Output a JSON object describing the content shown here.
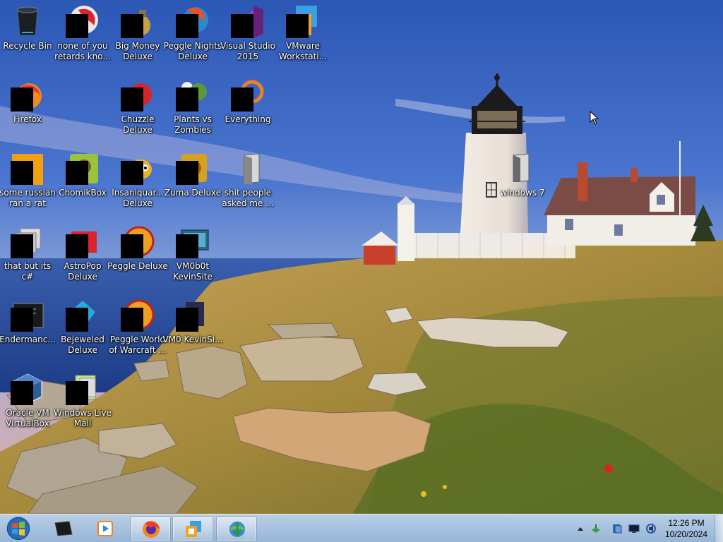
{
  "desktop": {
    "icons": [
      {
        "label": "Recycle Bin",
        "icon": "recycle-bin-icon"
      },
      {
        "label": "none of you retards kno...",
        "icon": "app-icon"
      },
      {
        "label": "Big Money Deluxe",
        "icon": "game-icon"
      },
      {
        "label": "Peggle Nights Deluxe",
        "icon": "game-icon"
      },
      {
        "label": "Visual Studio 2015",
        "icon": "visual-studio-icon"
      },
      {
        "label": "VMware Workstati...",
        "icon": "vmware-icon"
      },
      {
        "label": "Firefox",
        "icon": "firefox-icon"
      },
      {
        "label": "Chuzzle Deluxe",
        "icon": "game-icon"
      },
      {
        "label": "Plants vs Zombies",
        "icon": "game-icon"
      },
      {
        "label": "Everything",
        "icon": "search-icon"
      },
      {
        "label": "some russian ran a rat",
        "icon": "app-icon"
      },
      {
        "label": "ChomikBox",
        "icon": "app-icon"
      },
      {
        "label": "Insaniquar... Deluxe",
        "icon": "game-icon"
      },
      {
        "label": "Zuma Deluxe",
        "icon": "game-icon"
      },
      {
        "label": "shit people asked me ...",
        "icon": "folder-icon"
      },
      {
        "label": "that but its c#",
        "icon": "app-icon"
      },
      {
        "label": "AstroPop Deluxe",
        "icon": "game-icon"
      },
      {
        "label": "Peggle Deluxe",
        "icon": "game-icon"
      },
      {
        "label": "VM0b0t KevinSite",
        "icon": "app-icon"
      },
      {
        "label": "Endermanc...",
        "icon": "app-icon"
      },
      {
        "label": "Bejeweled Deluxe",
        "icon": "game-icon"
      },
      {
        "label": "Peggle World of Warcraft ...",
        "icon": "game-icon"
      },
      {
        "label": "VM0 KevinSi...",
        "icon": "app-icon"
      },
      {
        "label": "Oracle VM VirtualBox",
        "icon": "virtualbox-icon"
      },
      {
        "label": "Windows Live Mail",
        "icon": "mail-icon"
      }
    ],
    "extra_icon": {
      "label": "windows 7",
      "icon": "document-icon"
    }
  },
  "taskbar": {
    "start_icon": "windows-start-icon",
    "pinned": [
      {
        "name": "terminal",
        "icon": "terminal-icon",
        "active": false
      },
      {
        "name": "media player",
        "icon": "media-player-icon",
        "active": false
      },
      {
        "name": "firefox",
        "icon": "firefox-icon",
        "active": true
      },
      {
        "name": "vmware",
        "icon": "vmware-icon",
        "active": true
      },
      {
        "name": "download manager",
        "icon": "download-manager-icon",
        "active": true
      }
    ],
    "tray": {
      "icons": [
        "chevron-up-icon",
        "network-icon",
        "security-icon",
        "monitor-icon",
        "volume-icon"
      ],
      "time": "12:26 PM",
      "date": "10/20/2024"
    }
  },
  "colors": {
    "sky_top": "#2f5bb8",
    "sea": "#2a4fa0",
    "grass": "#a08a3a",
    "taskbar": "#a9c3df"
  }
}
